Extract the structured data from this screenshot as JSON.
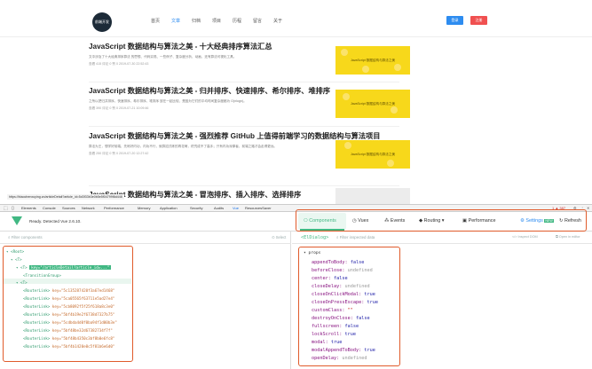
{
  "site": {
    "logo_text": "前端开发",
    "nav": [
      "首页",
      "文章",
      "归档",
      "项目",
      "历程",
      "留言",
      "关于"
    ],
    "login": "登录",
    "register": "注册"
  },
  "articles": [
    {
      "title": "JavaScript 数据结构与算法之美 - 十大经典排序算法汇总",
      "summary": "文中涉及了十大经典排序算法 的思想、代码实现、一些例子、复杂度分析、动画、还有算法可视化工具。",
      "meta": "查看 415   评论 0   赞 0   2019-07-30 22:52:43",
      "thumb": "JavaScript 数据结构与算法之美"
    },
    {
      "title": "JavaScript 数据结构与算法之美 - 归并排序、快速排序、希尔排序、堆排序",
      "summary": "之所以把归并排序、快速排序、希尔排序、堆排序 放在一起比较，是因为它们的平均时间复杂度都为 O(nlogn)。",
      "meta": "查看 390   评论 0   赞 0   2019-07-21 10:09:46",
      "thumb": "JavaScript 数据结构与算法之美"
    },
    {
      "title": "JavaScript 数据结构与算法之美 - 强烈推荐 GitHub 上值得前端学习的数据结构与算法项目",
      "summary": "算法为王，想学好前端，先练好内功，内功不行，就算招式练的再花哨，终究成不了高手；只有内功深厚者，前端之路才会走得更远。",
      "meta": "查看 250   评论 0   赞 0   2019-07-20 12:27:42",
      "thumb": "JavaScript 数据结构与算法之美"
    },
    {
      "title": "JavaScript 数据结构与算法之美 - 冒泡排序、插入排序、选择排序",
      "thumb": ""
    }
  ],
  "status_url": "https://biaochenxuying.cn/articleDetail?article_id=5d3f33b3e0b5e5f04799f8d448",
  "devtools": {
    "tabs": [
      "Elements",
      "Console",
      "Sources",
      "Network",
      "Performance",
      "Memory",
      "Application",
      "Security",
      "Audits",
      "Vue",
      "ResourcesSaver"
    ],
    "active_tab": "Vue",
    "counts": "1 ▲ 387"
  },
  "vue": {
    "ready_text": "Ready. Detected Vue 2.6.10.",
    "tabs": [
      "Components",
      "Vuex",
      "Events",
      "Routing",
      "Performance",
      "Settings",
      "Refresh"
    ],
    "settings_badge": "NEW",
    "filter_placeholder": "Filter components",
    "select_label": "Select",
    "selected_component": "<ElDialog>",
    "filter_data_placeholder": "Filter inspected data",
    "inspect_dom": "Inspect DOM",
    "open_editor": "Open in editor",
    "props_header": "▾ props"
  },
  "tree": [
    {
      "indent": 0,
      "text": "▾ <Root>"
    },
    {
      "indent": 1,
      "text": "▾ <T>"
    },
    {
      "indent": 2,
      "text": "▾ <T>",
      "key": "key=\"/articleDetail?article_id=...\""
    },
    {
      "indent": 3,
      "text": "<TransitionGroup>"
    },
    {
      "indent": 2,
      "text": "▾ <T>"
    },
    {
      "indent": 3,
      "text": "<RouterLink>",
      "key": "key=\"5c135287420f3a67ed1468\""
    },
    {
      "indent": 3,
      "text": "<RouterLink>",
      "key": "key=\"5ca05565f63711e5ad27e4\""
    },
    {
      "indent": 3,
      "text": "<RouterLink>",
      "key": "key=\"5cb8092f5f25f618a8c3e0\""
    },
    {
      "indent": 3,
      "text": "<RouterLink>",
      "key": "key=\"5bf4b19e2f6738d7327b75\""
    },
    {
      "indent": 3,
      "text": "<RouterLink>",
      "key": "key=\"5cdbda4d0f0ba94f1d00b3e\""
    },
    {
      "indent": 3,
      "text": "<RouterLink>",
      "key": "key=\"5bf48be32d67382734f7f\""
    },
    {
      "indent": 3,
      "text": "<RouterLink>",
      "key": "key=\"5bf48b4350c3bf8b0e6fc8\""
    },
    {
      "indent": 3,
      "text": "<RouterLink>",
      "key": "key=\"5bf4b1420e0c5f81b6e6d0\""
    }
  ],
  "props": [
    {
      "name": "appendToBody",
      "value": "false",
      "type": "bool"
    },
    {
      "name": "beforeClose",
      "value": "undefined",
      "type": "undef"
    },
    {
      "name": "center",
      "value": "false",
      "type": "bool"
    },
    {
      "name": "closeDelay",
      "value": "undefined",
      "type": "undef"
    },
    {
      "name": "closeOnClickModal",
      "value": "true",
      "type": "bool"
    },
    {
      "name": "closeOnPressEscape",
      "value": "true",
      "type": "bool"
    },
    {
      "name": "customClass",
      "value": "\"\"",
      "type": "str"
    },
    {
      "name": "destroyOnClose",
      "value": "false",
      "type": "bool"
    },
    {
      "name": "fullscreen",
      "value": "false",
      "type": "bool"
    },
    {
      "name": "lockScroll",
      "value": "true",
      "type": "bool"
    },
    {
      "name": "modal",
      "value": "true",
      "type": "bool"
    },
    {
      "name": "modalAppendToBody",
      "value": "true",
      "type": "bool"
    },
    {
      "name": "openDelay",
      "value": "undefined",
      "type": "undef"
    }
  ]
}
